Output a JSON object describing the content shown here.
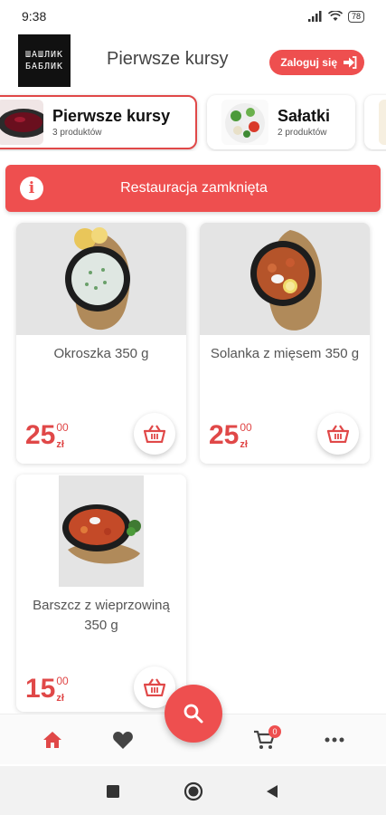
{
  "status_bar": {
    "time": "9:38",
    "battery": "78"
  },
  "header": {
    "logo_line1": "ШАШЛИК",
    "logo_line2": "БАБЛИК",
    "title": "Pierwsze kursy",
    "login_label": "Zaloguj się"
  },
  "categories": [
    {
      "name": "Pierwsze kursy",
      "count": "3 produktów",
      "active": true
    },
    {
      "name": "Sałatki",
      "count": "2 produktów",
      "active": false
    }
  ],
  "banner": {
    "text": "Restauracja zamknięta",
    "icon": "info-icon"
  },
  "products": [
    {
      "name": "Okroszka 350 g",
      "price_int": "25",
      "price_dec": "00",
      "currency": "zł"
    },
    {
      "name": "Solanka z mięsem 350 g",
      "price_int": "25",
      "price_dec": "00",
      "currency": "zł"
    },
    {
      "name": "Barszcz z wieprzowiną 350 g",
      "price_int": "15",
      "price_dec": "00",
      "currency": "zł"
    }
  ],
  "bottom_nav": {
    "items": [
      "home-icon",
      "heart-icon",
      "cart-icon",
      "more-icon"
    ],
    "cart_badge": "0",
    "fab_icon": "search-icon"
  },
  "colors": {
    "accent": "#ee4f4f",
    "active_nav": "#e04848",
    "inactive_nav": "#444444"
  }
}
